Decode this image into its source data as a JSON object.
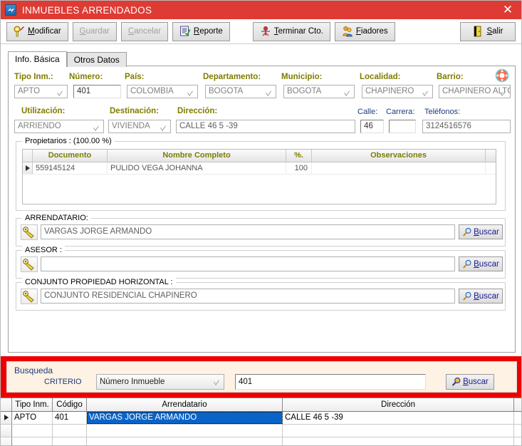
{
  "window": {
    "title": "INMUEBLES ARRENDADOS",
    "icon": "app-icon",
    "close_label": "✕"
  },
  "toolbar": {
    "buttons": [
      {
        "label_pre": "",
        "accel": "M",
        "label_post": "odificar",
        "icon": "key-pencil-icon",
        "enabled": true,
        "name": "modificar-button"
      },
      {
        "label_pre": "",
        "accel": "G",
        "label_post": "uardar",
        "icon": "none",
        "enabled": false,
        "name": "guardar-button"
      },
      {
        "label_pre": "",
        "accel": "C",
        "label_post": "ancelar",
        "icon": "none",
        "enabled": false,
        "name": "cancelar-button"
      },
      {
        "label_pre": "",
        "accel": "R",
        "label_post": "eporte",
        "icon": "report-checklist-icon",
        "enabled": true,
        "name": "reporte-button"
      },
      {
        "label_pre": "",
        "accel": "T",
        "label_post": "erminar Cto.",
        "icon": "terminate-contract-icon",
        "enabled": true,
        "name": "terminar-cto-button"
      },
      {
        "label_pre": "",
        "accel": "F",
        "label_post": "iadores",
        "icon": "people-icon",
        "enabled": true,
        "name": "fiadores-button"
      },
      {
        "label_pre": "",
        "accel": "S",
        "label_post": "alir",
        "icon": "exit-door-icon",
        "enabled": true,
        "name": "salir-button"
      }
    ]
  },
  "tabs": [
    {
      "label": "Info. Básica",
      "active": true
    },
    {
      "label": "Otros Datos",
      "active": false
    }
  ],
  "help_icon": "lifesaver-help-icon",
  "form": {
    "tipo_inm": {
      "label": "Tipo Inm.:",
      "value": "APTO",
      "control": "combo"
    },
    "numero": {
      "label": "Número:",
      "value": "401",
      "control": "text"
    },
    "pais": {
      "label": "País:",
      "value": "COLOMBIA",
      "control": "combo"
    },
    "departamento": {
      "label": "Departamento:",
      "value": "BOGOTA",
      "control": "combo"
    },
    "municipio": {
      "label": "Municipio:",
      "value": "BOGOTA",
      "control": "combo"
    },
    "localidad": {
      "label": "Localidad:",
      "value": "CHAPINERO",
      "control": "combo"
    },
    "barrio": {
      "label": "Barrio:",
      "value": "CHAPINERO ALTᑕ",
      "control": "combo"
    },
    "utilizacion": {
      "label": "Utilización:",
      "value": "ARRIENDO",
      "control": "combo"
    },
    "destinacion": {
      "label": "Destinación:",
      "value": "VIVIENDA",
      "control": "combo"
    },
    "direccion": {
      "label": "Dirección:",
      "value": "CALLE 46 5 -39",
      "control": "text"
    },
    "calle": {
      "label": "Calle:",
      "value": "46",
      "control": "text"
    },
    "carrera": {
      "label": "Carrera:",
      "value": "",
      "control": "text"
    },
    "telefonos": {
      "label": "Teléfonos:",
      "value": "3124516576",
      "control": "text"
    }
  },
  "propietarios": {
    "group_title": "Propietarios : (100.00 %)",
    "columns": [
      "Documento",
      "Nombre Completo",
      "%.",
      "Observaciones"
    ],
    "rows": [
      {
        "documento": "559145124",
        "nombre": "PULIDO VEGA JOHANNA",
        "pct": "100",
        "observaciones": ""
      }
    ]
  },
  "sections": [
    {
      "name": "arrendatario",
      "title": "ARRENDATARIO:",
      "value": "VARGAS  JORGE ARMANDO",
      "button": {
        "accel": "B",
        "label_post": "uscar",
        "icon": "magnifier-icon"
      },
      "key_icon": "key-icon"
    },
    {
      "name": "asesor",
      "title": "ASESOR :",
      "value": "",
      "button": {
        "accel": "B",
        "label_post": "uscar",
        "icon": "magnifier-icon"
      },
      "key_icon": "key-icon"
    },
    {
      "name": "conjunto-propiedad-horizontal",
      "title": "CONJUNTO PROPIEDAD HORIZONTAL :",
      "value": "CONJUNTO RESIDENCIAL CHAPINERO",
      "button": {
        "accel": "B",
        "label_post": "uscar",
        "icon": "magnifier-icon"
      },
      "key_icon": "key-icon"
    }
  ],
  "busqueda": {
    "title": "Busqueda",
    "criterio_label": "CRITERIO",
    "criterio_value": "Número Inmueble",
    "query_value": "401",
    "buscar": {
      "accel": "B",
      "label_post": "uscar",
      "icon": "magnifier-search-icon"
    }
  },
  "results": {
    "columns": [
      "Tipo Inm.",
      "Código",
      "Arrendatario",
      "Dirección"
    ],
    "rows": [
      {
        "tipo": "APTO",
        "codigo": "401",
        "arrendatario": "VARGAS  JORGE ARMANDO",
        "direccion": "CALLE 46 5 -39",
        "selected": true
      }
    ],
    "blank_rows": 2
  },
  "colors": {
    "titlebar": "#dd3b34",
    "accent_red": "#ee0000",
    "label_olive": "#7d7d00",
    "label_navy": "#1e3a7b",
    "selection_blue": "#0a64c8",
    "panel_cream": "#fdf2e3"
  }
}
